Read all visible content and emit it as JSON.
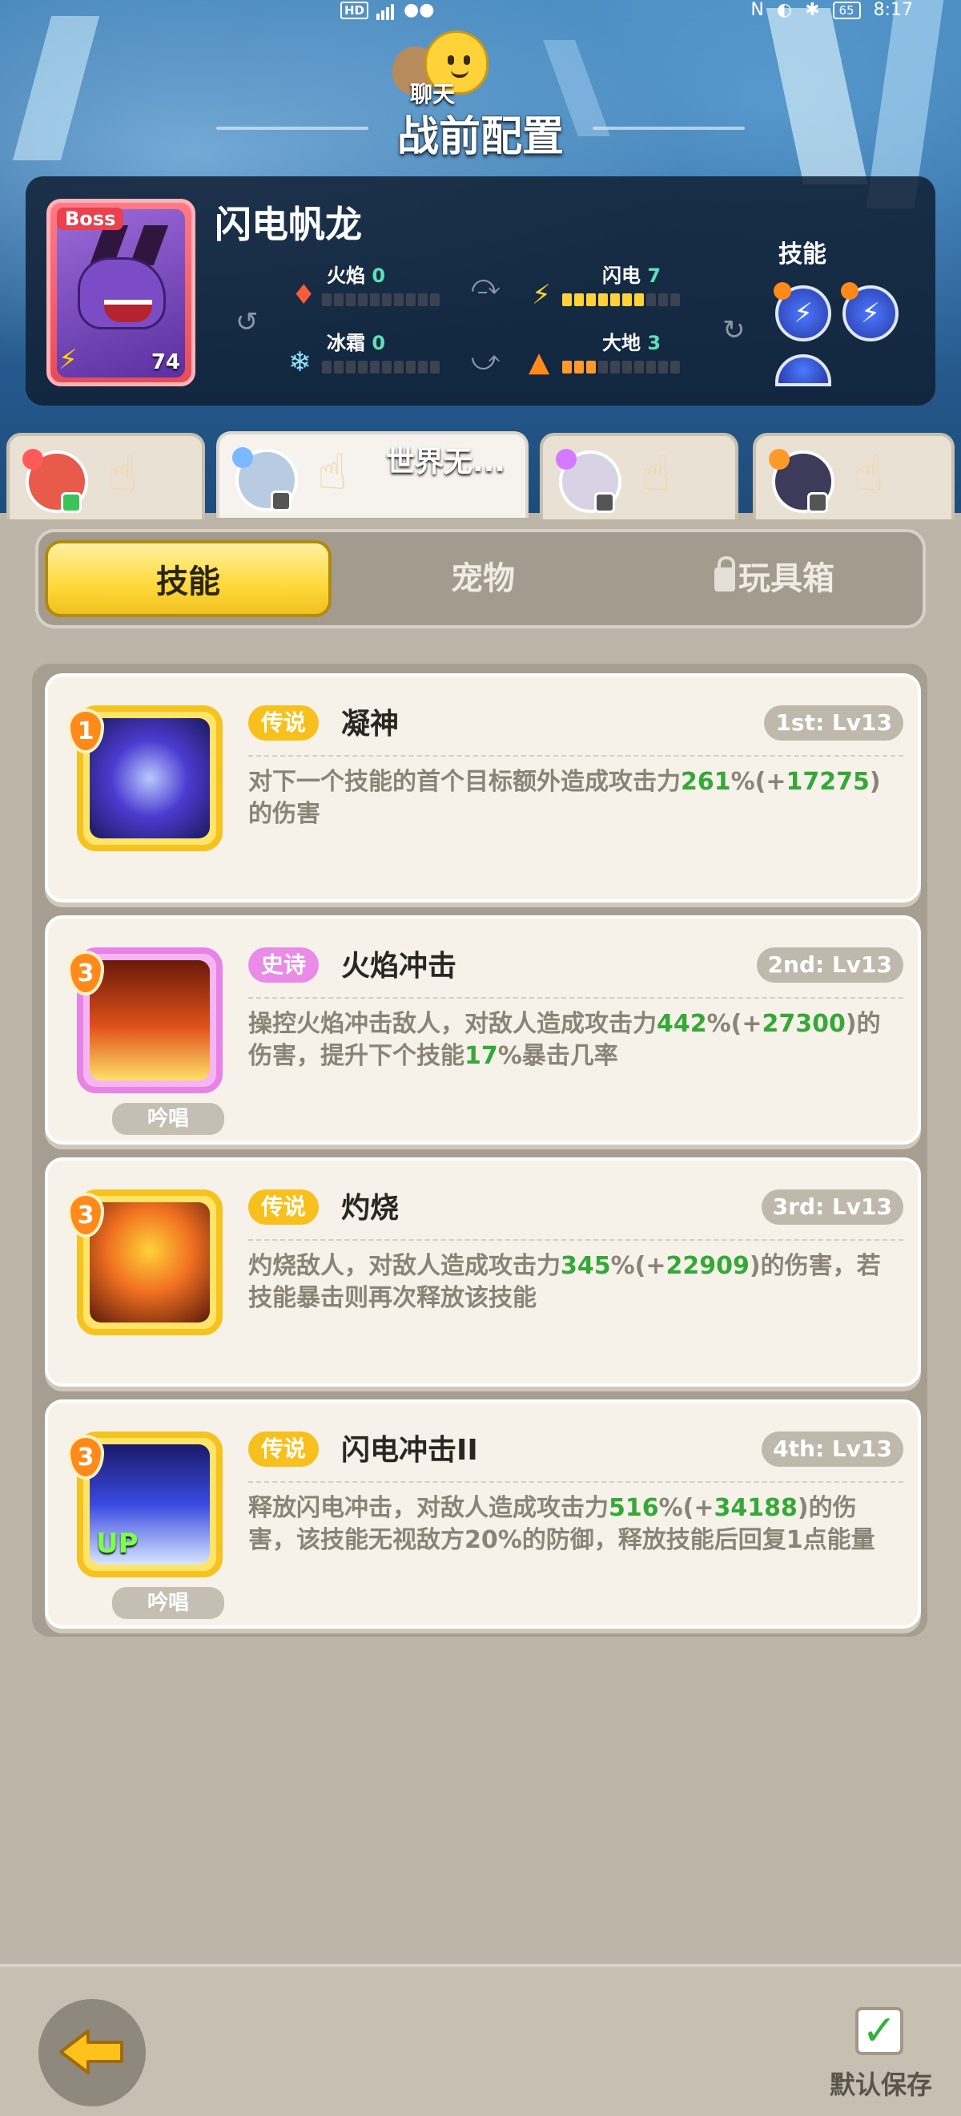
{
  "status_bar": {
    "network": "HD",
    "time": "8:17",
    "battery": "65"
  },
  "header": {
    "chat_label": "聊天",
    "title": "战前配置"
  },
  "boss": {
    "tag": "Boss",
    "name": "闪电帆龙",
    "level": "74",
    "elements": [
      {
        "label": "火焰",
        "value": "0",
        "filled": 0
      },
      {
        "label": "闪电",
        "value": "7",
        "filled": 7
      },
      {
        "label": "冰霜",
        "value": "0",
        "filled": 0
      },
      {
        "label": "大地",
        "value": "3",
        "filled": 3
      }
    ],
    "skills_label": "技能"
  },
  "hero_tabs": [
    {
      "name": ""
    },
    {
      "name": "世界无..."
    },
    {
      "name": ""
    },
    {
      "name": ""
    }
  ],
  "segments": {
    "skills": "技能",
    "pets": "宠物",
    "toybox": "玩具箱"
  },
  "skills": [
    {
      "order": "1",
      "rarity": "传说",
      "name": "凝神",
      "level": "1st: Lv13",
      "desc_parts": [
        "对下一个技能的首个目标额外造成攻击力",
        "261",
        "%(+",
        "17275",
        ")的伤害"
      ]
    },
    {
      "order": "3",
      "rarity": "史诗",
      "name": "火焰冲击",
      "level": "2nd: Lv13",
      "chant": "吟唱",
      "desc_parts": [
        "操控火焰冲击敌人，对敌人造成攻击力",
        "442",
        "%(+",
        "27300",
        ")的伤害，提升下个技能",
        "17",
        "%暴击几率"
      ]
    },
    {
      "order": "3",
      "rarity": "传说",
      "name": "灼烧",
      "level": "3rd: Lv13",
      "desc_parts": [
        "灼烧敌人，对敌人造成攻击力",
        "345",
        "%(+",
        "22909",
        ")的伤害，若技能暴击则再次释放该技能"
      ]
    },
    {
      "order": "3",
      "rarity": "传说",
      "name": "闪电冲击II",
      "level": "4th: Lv13",
      "chant": "吟唱",
      "up": "UP",
      "desc_parts": [
        "释放闪电冲击，对敌人造成攻击力",
        "516",
        "%(+",
        "34188",
        ")的伤害，该技能无视敌方20%的防御，释放技能后回复1点能量"
      ]
    }
  ],
  "footer": {
    "save_label": "默认保存"
  },
  "colors": {
    "legend": "#f8c01c",
    "epic": "#e98be7",
    "highlight": "#35a838"
  }
}
